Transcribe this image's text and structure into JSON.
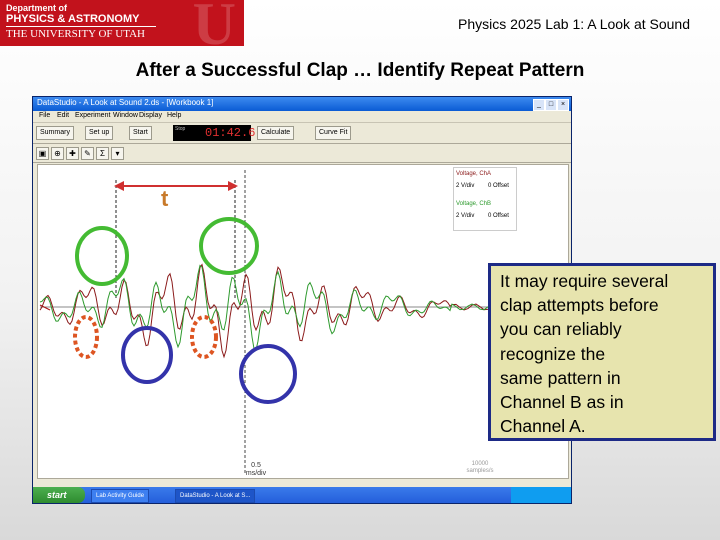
{
  "logo": {
    "line1": "Department of",
    "line2": "PHYSICS & ASTRONOMY",
    "line3": "THE UNIVERSITY OF UTAH",
    "monogram": "U"
  },
  "header": {
    "title": "Physics 2025  Lab 1: A Look at Sound"
  },
  "slide": {
    "title": "After a Successful Clap … Identify Repeat Pattern"
  },
  "app": {
    "window_title": "DataStudio - A Look at Sound 2.ds - [Workbook 1]",
    "window_buttons": [
      "_",
      "□",
      "×"
    ],
    "menu": [
      "File",
      "Edit",
      "Experiment",
      "Window",
      "Display",
      "Help"
    ],
    "toolbar": {
      "summary": "Summary",
      "setup": "Set up",
      "start": "Start",
      "clock_label": "Stop",
      "clock_value": "01:42.6",
      "calculate": "Calculate",
      "curve_fit": "Curve Fit"
    },
    "legend": {
      "channel_a": "Voltage, ChA",
      "channel_a_scale": "2 V/div",
      "channel_a_offset": "0 Offset",
      "channel_b": "Voltage, ChB",
      "channel_b_scale": "2 V/div",
      "channel_b_offset": "0 Offset"
    },
    "x_scale": {
      "value": "0.5",
      "unit": "ms/div"
    },
    "sample_rate": {
      "value": "10000",
      "unit": "samples/s"
    },
    "taskbar": {
      "start": "start",
      "tasks": [
        "Lab Activity Guide",
        "DataStudio - A Look at S..."
      ]
    }
  },
  "annotations": {
    "period_label": "t",
    "note": [
      "It may require several",
      "clap attempts before",
      "you can reliably",
      "recognize the",
      "same pattern in",
      "Channel B as in",
      "Channel A."
    ]
  },
  "colors": {
    "utah_red": "#c2121c",
    "channel_a": "#8b1a1a",
    "channel_b": "#2e9a2e",
    "circle_green": "#44bb33",
    "circle_blue": "#3333aa",
    "circle_red": "#dd5522",
    "arrow": "#d03030",
    "note_bg": "#e7e4ae",
    "note_border": "#1d2a86"
  }
}
